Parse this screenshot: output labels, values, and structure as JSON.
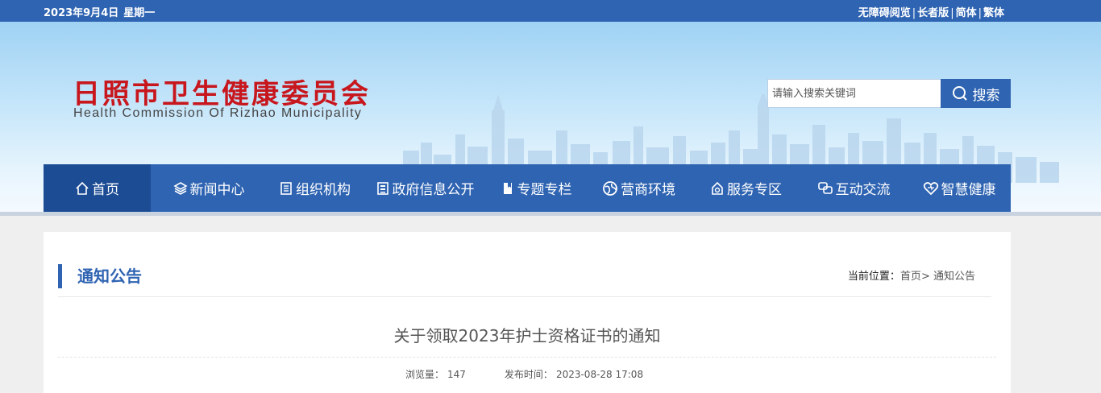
{
  "topbar": {
    "date": "2023年9月4日",
    "weekday": "星期一",
    "links": [
      "无障碍阅览",
      "长者版",
      "简体",
      "繁体"
    ]
  },
  "header": {
    "title_cn": "日照市卫生健康委员会",
    "title_en": "Health Commission Of Rizhao Municipality"
  },
  "search": {
    "placeholder": "请输入搜索关键词",
    "button": "搜索"
  },
  "nav": {
    "items": [
      {
        "label": "首页",
        "icon": "home-icon"
      },
      {
        "label": "新闻中心",
        "icon": "layers-icon"
      },
      {
        "label": "组织机构",
        "icon": "document-icon"
      },
      {
        "label": "政府信息公开",
        "icon": "list-icon"
      },
      {
        "label": "专题专栏",
        "icon": "bookmark-icon"
      },
      {
        "label": "营商环境",
        "icon": "globe-icon"
      },
      {
        "label": "服务专区",
        "icon": "service-icon"
      },
      {
        "label": "互动交流",
        "icon": "chat-icon"
      },
      {
        "label": "智慧健康",
        "icon": "heart-icon"
      }
    ]
  },
  "section": {
    "title": "通知公告"
  },
  "breadcrumb": {
    "label": "当前位置：",
    "home": "首页",
    "separator": ">",
    "current": "通知公告"
  },
  "article": {
    "title": "关于领取2023年护士资格证书的通知",
    "views_label": "浏览量：",
    "views": "147",
    "published_label": "发布时间：",
    "published": "2023-08-28 17:08"
  },
  "colors": {
    "primary": "#2f64b2",
    "nav_active": "#1c4c94",
    "logo_red": "#c8161d"
  }
}
